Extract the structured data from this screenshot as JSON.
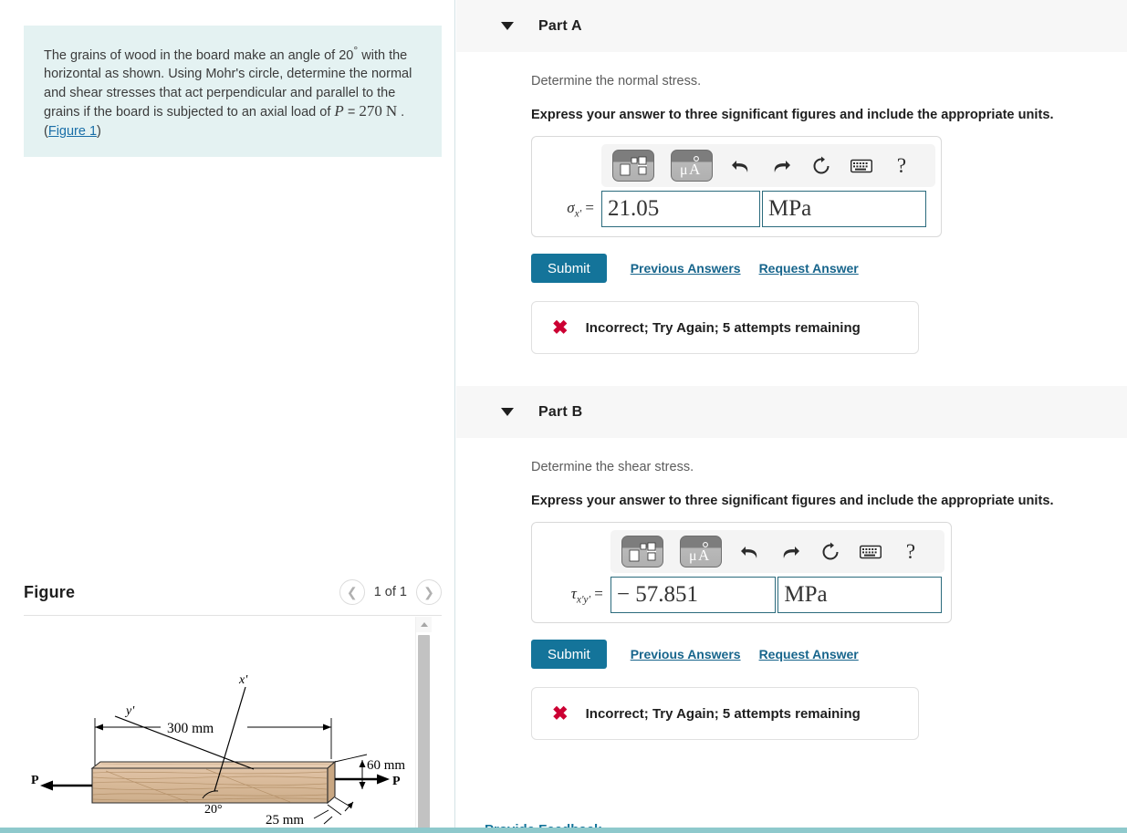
{
  "problem": {
    "text_before_angle": "The grains of wood in the board make an angle of 20",
    "degree": "°",
    "text_mid": "with the horizontal as shown. Using Mohr's circle, determine the normal and shear stresses that act perpendicular and parallel to the grains if the board is subjected to an axial load of ",
    "load_symbol": "P",
    "load_eq": "=",
    "load_value": "270",
    "load_unit": "N",
    "tail_period": ".",
    "figure_link": "Figure 1",
    "paren_open": "(",
    "paren_close": ")"
  },
  "figure": {
    "title": "Figure",
    "prev_icon": "chevron-left-icon",
    "next_icon": "chevron-right-icon",
    "counter": "1 of 1",
    "diagram": {
      "force_left_label": "P",
      "force_right_label": "P",
      "length_label": "300 mm",
      "height_label": "60 mm",
      "thickness_label": "25 mm",
      "angle_label": "20°",
      "axis_x_label": "x'",
      "axis_y_label": "y'",
      "board_color": "#d6b89a",
      "board_edge_color": "#c4a078"
    }
  },
  "parts": [
    {
      "title": "Part A",
      "caret_icon": "caret-down-icon",
      "prompt": "Determine the normal stress.",
      "instruction": "Express your answer to three significant figures and include the appropriate units.",
      "toolbar": {
        "template_icon": "math-template-icon",
        "units_icon": "units-micro-angstrom-icon",
        "units_label": "μÅ",
        "undo_icon": "undo-icon",
        "redo_icon": "redo-icon",
        "reset_icon": "reset-icon",
        "keyboard_icon": "keyboard-icon",
        "help_icon": "help-icon",
        "help_label": "?"
      },
      "variable_base": "σ",
      "variable_sub": "x'",
      "equals": "=",
      "value": "21.05",
      "value_placeholder": "",
      "unit": "MPa",
      "unit_placeholder": "",
      "submit_label": "Submit",
      "previous_answers_label": "Previous Answers",
      "request_answer_label": "Request Answer",
      "feedback_icon": "incorrect-x-icon",
      "feedback_mark": "✖",
      "feedback_text": "Incorrect; Try Again; 5 attempts remaining"
    },
    {
      "title": "Part B",
      "caret_icon": "caret-down-icon",
      "prompt": "Determine the shear stress.",
      "instruction": "Express your answer to three significant figures and include the appropriate units.",
      "toolbar": {
        "template_icon": "math-template-icon",
        "units_icon": "units-micro-angstrom-icon",
        "units_label": "μÅ",
        "undo_icon": "undo-icon",
        "redo_icon": "redo-icon",
        "reset_icon": "reset-icon",
        "keyboard_icon": "keyboard-icon",
        "help_icon": "help-icon",
        "help_label": "?"
      },
      "variable_base": "τ",
      "variable_sub": "x'y'",
      "equals": "=",
      "value": "− 57.851",
      "value_placeholder": "",
      "unit": "MPa",
      "unit_placeholder": "",
      "submit_label": "Submit",
      "previous_answers_label": "Previous Answers",
      "request_answer_label": "Request Answer",
      "feedback_icon": "incorrect-x-icon",
      "feedback_mark": "✖",
      "feedback_text": "Incorrect; Try Again; 5 attempts remaining"
    }
  ],
  "footer": {
    "provide_feedback_label": "Provide Feedback"
  },
  "colors": {
    "accent_teal": "#14749a",
    "problem_bg": "#e4f2f2",
    "part_header_bg": "#f7f7f7",
    "error_red": "#cc0033",
    "input_border": "#2b6b7d",
    "footer_rule": "#8ec9cc"
  }
}
